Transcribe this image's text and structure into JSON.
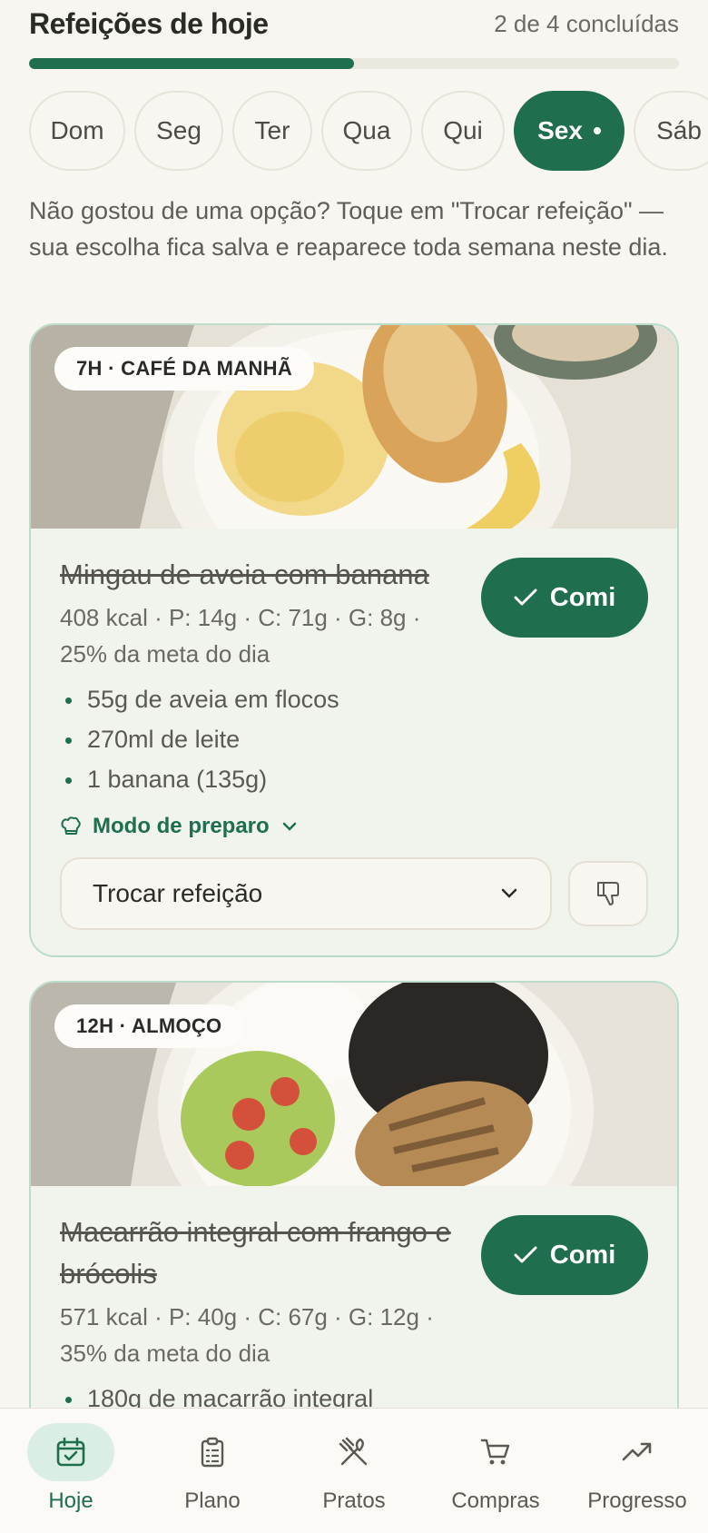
{
  "header": {
    "title": "Refeições de hoje",
    "progress_text": "2 de 4 concluídas",
    "progress_fraction": 0.5
  },
  "days": [
    {
      "label": "Dom",
      "active": false
    },
    {
      "label": "Seg",
      "active": false
    },
    {
      "label": "Ter",
      "active": false
    },
    {
      "label": "Qua",
      "active": false
    },
    {
      "label": "Qui",
      "active": false
    },
    {
      "label": "Sex",
      "active": true
    },
    {
      "label": "Sáb",
      "active": false
    }
  ],
  "hint": "Não gostou de uma opção? Toque em \"Trocar refeição\" — sua escolha fica salva e reaparece toda semana neste dia.",
  "meals": [
    {
      "time_label": "7H · CAFÉ DA MANHÃ",
      "name": "Mingau de aveia com banana",
      "macros": "408 kcal · P: 14g · C: 71g · G: 8g · 25% da meta do dia",
      "eat_label": "Comi",
      "ingredients": [
        "55g de aveia em flocos",
        "270ml de leite",
        "1 banana (135g)"
      ],
      "prep_label": "Modo de preparo",
      "swap_label": "Trocar refeição"
    },
    {
      "time_label": "12H · ALMOÇO",
      "name": "Macarrão integral com frango e brócolis",
      "macros": "571 kcal · P: 40g · C: 67g · G: 12g · 35% da meta do dia",
      "eat_label": "Comi",
      "ingredients": [
        "180g de macarrão integral"
      ]
    }
  ],
  "nav": [
    {
      "label": "Hoje",
      "icon": "calendar-check-icon",
      "active": true
    },
    {
      "label": "Plano",
      "icon": "clipboard-icon",
      "active": false
    },
    {
      "label": "Pratos",
      "icon": "utensils-icon",
      "active": false
    },
    {
      "label": "Compras",
      "icon": "cart-icon",
      "active": false
    },
    {
      "label": "Progresso",
      "icon": "trending-up-icon",
      "active": false
    }
  ],
  "colors": {
    "accent": "#1f6e4e",
    "background": "#f8f6f0",
    "card_border": "#b9dccb"
  }
}
